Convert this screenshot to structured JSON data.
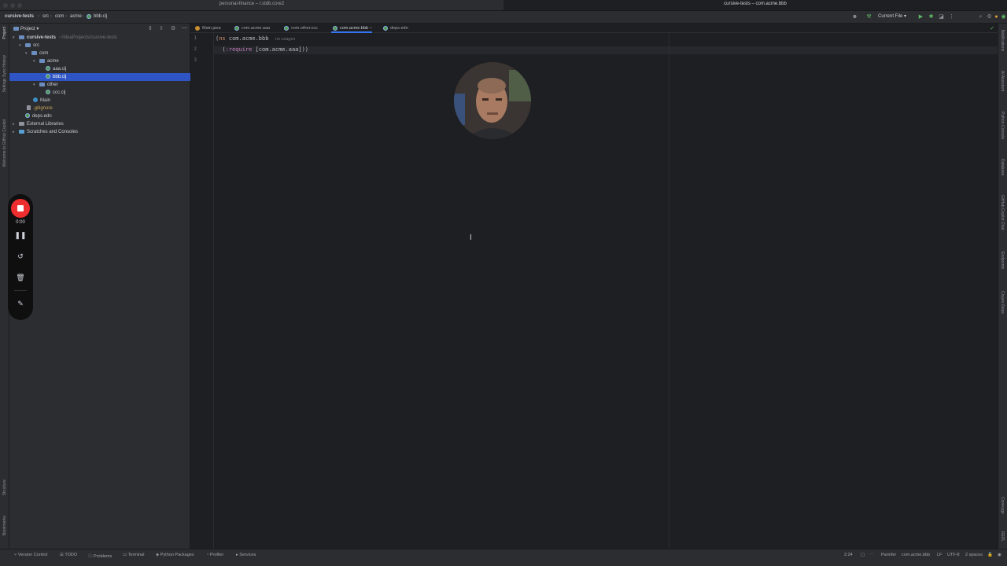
{
  "window": {
    "left_title": "personal-finance – r.stdb.core2",
    "right_title": "cursive-tests – com.acme.bbb"
  },
  "breadcrumb": [
    "cursive-tests",
    "src",
    "com",
    "acme",
    "bbb.clj"
  ],
  "toolbar": {
    "run_config": "Current File",
    "icons": [
      "profile-icon",
      "hammer-icon",
      "run-icon",
      "debug-icon",
      "coverage-icon",
      "profile-run-icon",
      "search-icon",
      "settings-icon",
      "avatar-icon",
      "copilot-icon"
    ]
  },
  "left_strip": {
    "top_items": [
      "Project",
      "Settings Sync History",
      "Welcome to GitHub Copilot"
    ],
    "bottom_items": [
      "Structure",
      "Bookmarks"
    ]
  },
  "project_panel": {
    "title": "Project",
    "tree": [
      {
        "label": "cursive-tests",
        "hint": "~/IdeaProjects/cursive-tests",
        "type": "folder",
        "depth": 0,
        "expanded": true
      },
      {
        "label": "src",
        "type": "folder",
        "depth": 1,
        "expanded": true
      },
      {
        "label": "com",
        "type": "folder",
        "depth": 2,
        "expanded": true
      },
      {
        "label": "acme",
        "type": "folder",
        "depth": 3,
        "expanded": true
      },
      {
        "label": "aaa.clj",
        "type": "clj",
        "depth": 4
      },
      {
        "label": "bbb.clj",
        "type": "clj",
        "depth": 4,
        "selected": true
      },
      {
        "label": "other",
        "type": "folder",
        "depth": 3,
        "expanded": true
      },
      {
        "label": "ccc.clj",
        "type": "clj",
        "depth": 4
      },
      {
        "label": "Main",
        "type": "java",
        "depth": 2
      },
      {
        "label": ".gitignore",
        "type": "file",
        "depth": 1
      },
      {
        "label": "deps.edn",
        "type": "clj",
        "depth": 1
      },
      {
        "label": "External Libraries",
        "type": "folder",
        "depth": 0
      },
      {
        "label": "Scratches and Consoles",
        "type": "folder",
        "depth": 0
      }
    ]
  },
  "tabs": [
    {
      "label": "Main.java",
      "kind": "java",
      "active": false
    },
    {
      "label": "com.acme.aaa",
      "kind": "clj",
      "active": false
    },
    {
      "label": "com.other.ccc",
      "kind": "clj",
      "active": false
    },
    {
      "label": "com.acme.bbb",
      "kind": "clj",
      "active": true
    },
    {
      "label": "deps.edn",
      "kind": "clj",
      "active": false
    }
  ],
  "editor": {
    "line_numbers": [
      "1",
      "2",
      "3"
    ],
    "line1": {
      "open": "(",
      "kw": "ns",
      "name": " com.acme.bbb",
      "hint": "no usages"
    },
    "line2": {
      "indent": "  (",
      "kw": ":require",
      "rest": " [com.acme.aaa]))"
    }
  },
  "right_strip": [
    "Notifications",
    "AI Assistant",
    "Python Console",
    "Database",
    "GitHub Copilot Chat",
    "Endpoints",
    "Clojure Deps",
    "Coverage",
    "REPL"
  ],
  "recorder": {
    "time": "0:00"
  },
  "statusbar": {
    "left": [
      "Version Control",
      "TODO",
      "Problems",
      "Terminal",
      "Python Packages",
      "Profiler",
      "Services"
    ],
    "right": [
      "2:24",
      "Parinfer",
      "com.acme.bbb",
      "LF",
      "UTF-8",
      "2 spaces"
    ]
  }
}
